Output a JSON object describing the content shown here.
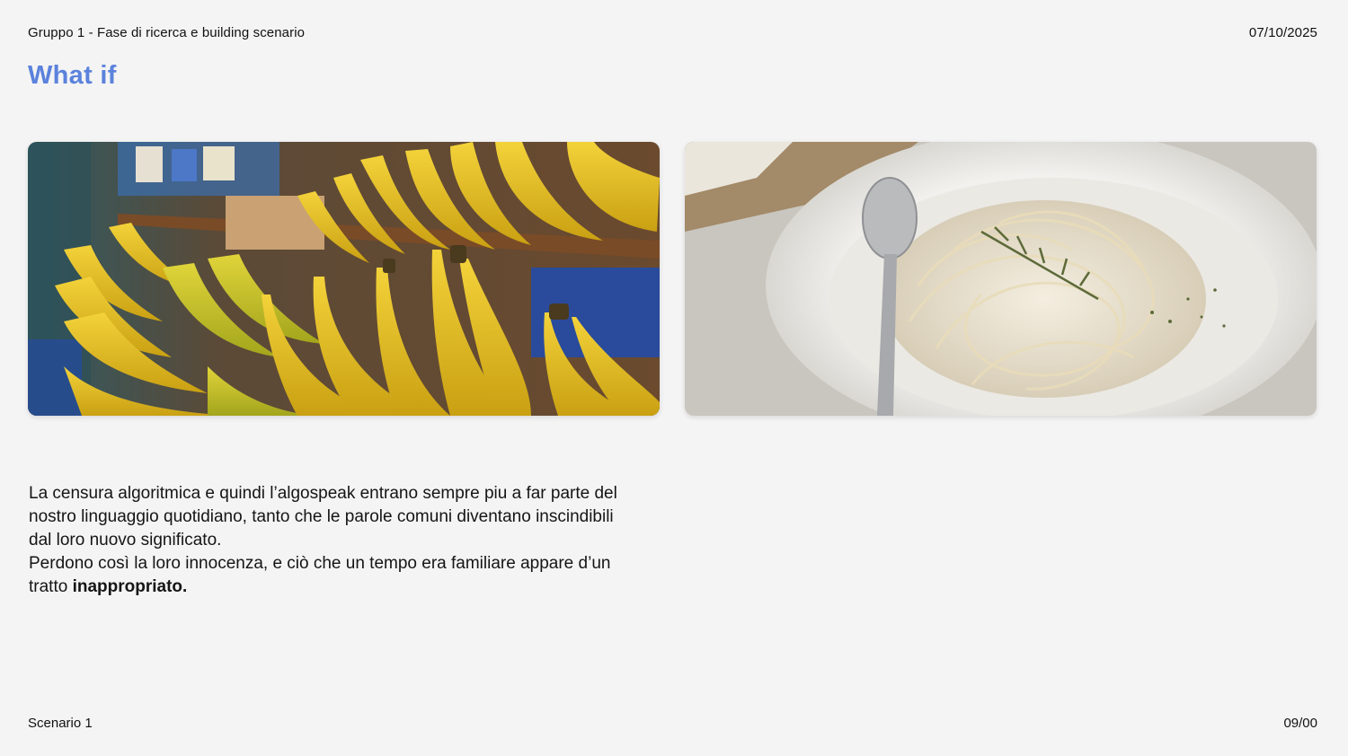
{
  "header": {
    "left": "Gruppo 1 - Fase di ricerca e building scenario",
    "right": "07/10/2025"
  },
  "title": "What if",
  "images": [
    {
      "name": "bananas-photo",
      "icon": "bananas-image"
    },
    {
      "name": "pasta-photo",
      "icon": "spaghetti-cream-sauce-image"
    }
  ],
  "body": {
    "paragraph1": "La censura algoritmica e quindi l’algospeak entrano sempre piu a far parte del nostro linguaggio quotidiano, tanto che le parole comuni diventano inscindibili dal loro nuovo significato.",
    "paragraph2_pre": "Perdono così la loro innocenza, e ciò che un tempo era familiare appare d’un tratto ",
    "paragraph2_bold": "inappropriato."
  },
  "footer": {
    "left": "Scenario 1",
    "right": "09/00"
  },
  "colors": {
    "accent": "#5b82dc",
    "background": "#f4f4f4",
    "text": "#111111"
  }
}
